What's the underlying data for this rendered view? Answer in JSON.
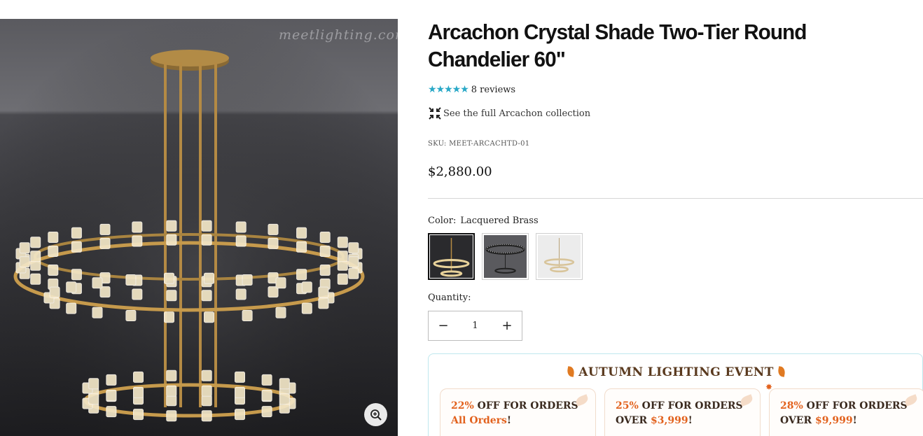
{
  "media": {
    "watermark": "meetlighting.com",
    "zoom_icon": "zoom-in-icon"
  },
  "product": {
    "title": "Arcachon Crystal Shade Two-Tier Round Chandelier 60\"",
    "rating": {
      "stars": "★★★★★",
      "review_count": "8 reviews",
      "star_color": "#29a8c7"
    },
    "collection_link": "See the full Arcachon collection",
    "sku": "SKU: MEET-ARCACHTD-01",
    "price": "$2,880.00"
  },
  "options": {
    "color_label": "Color:",
    "color_value": "Lacquered Brass",
    "swatches": [
      {
        "name": "Lacquered Brass",
        "selected": true
      },
      {
        "name": "Dark finish",
        "selected": false
      },
      {
        "name": "Light finish",
        "selected": false
      }
    ]
  },
  "quantity": {
    "label": "Quantity:",
    "value": "1",
    "minus": "−",
    "plus": "+"
  },
  "promo": {
    "title": "AUTUMN LIGHTING EVENT",
    "accent_color": "#e2621e",
    "cards": [
      {
        "pct": "22%",
        "text": " OFF FOR ORDERS",
        "line2": "All Orders",
        "end": "!"
      },
      {
        "pct": "25%",
        "text": " OFF FOR ORDERS",
        "line2_prefix": "OVER ",
        "line2": "$3,999",
        "end": "!"
      },
      {
        "pct": "28%",
        "text": " OFF FOR ORDERS",
        "line2_prefix": "OVER ",
        "line2": "$9,999",
        "end": "!"
      }
    ]
  }
}
